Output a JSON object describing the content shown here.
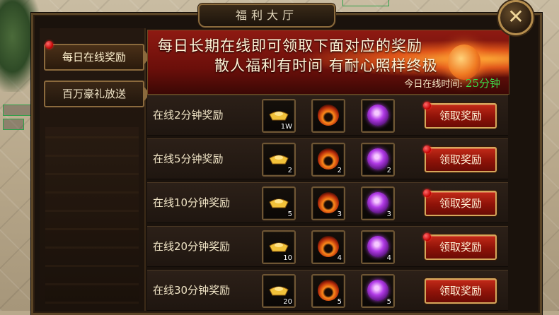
{
  "window": {
    "title": "福利大厅"
  },
  "nav": {
    "items": [
      {
        "label": "每日在线奖励"
      },
      {
        "label": "百万豪礼放送"
      }
    ]
  },
  "banner": {
    "line1": "每日长期在线即可领取下面对应的奖励",
    "line2": "散人福利有时间 有耐心照样终极",
    "online_label": "今日在线时间:",
    "online_value": "25分钟"
  },
  "rewards": [
    {
      "label": "在线2分钟奖励",
      "gold_qty": "1W",
      "fire_qty": "",
      "orb_qty": "",
      "button": "领取奖励"
    },
    {
      "label": "在线5分钟奖励",
      "gold_qty": "2",
      "fire_qty": "2",
      "orb_qty": "2",
      "button": "领取奖励"
    },
    {
      "label": "在线10分钟奖励",
      "gold_qty": "5",
      "fire_qty": "3",
      "orb_qty": "3",
      "button": "领取奖励"
    },
    {
      "label": "在线20分钟奖励",
      "gold_qty": "10",
      "fire_qty": "4",
      "orb_qty": "4",
      "button": "领取奖励"
    },
    {
      "label": "在线30分钟奖励",
      "gold_qty": "20",
      "fire_qty": "5",
      "orb_qty": "5",
      "button": "领取奖励"
    }
  ],
  "icons": {
    "gold": "gold-ingot-icon",
    "fire": "fire-stone-icon",
    "orb": "purple-orb-icon",
    "close": "crossed-swords-close-icon"
  },
  "colors": {
    "accent_gold": "#d4a85c",
    "button_red": "#c22a18",
    "online_green": "#3bdc4a"
  }
}
